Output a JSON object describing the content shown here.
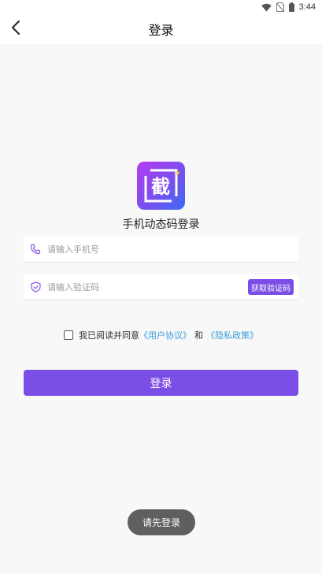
{
  "status_bar": {
    "time": "3:44",
    "icons": [
      "wifi-icon",
      "no-sim-icon",
      "battery-icon"
    ]
  },
  "header": {
    "title": "登录",
    "back_icon": "chevron-left-icon"
  },
  "logo": {
    "glyph": "截"
  },
  "subtitle": "手机动态码登录",
  "phone_field": {
    "icon": "phone-icon",
    "placeholder": "请输入手机号",
    "value": ""
  },
  "code_field": {
    "icon": "shield-icon",
    "placeholder": "请输入验证码",
    "value": "",
    "button_label": "获取验证码"
  },
  "agreement": {
    "checked": false,
    "prefix": "我已阅读并同意",
    "user_agreement": "《用户协议》",
    "and": "和",
    "privacy_policy": "《隐私政策》"
  },
  "login_button_label": "登录",
  "toast": "请先登录",
  "colors": {
    "accent": "#7b4fe6",
    "link": "#3a9ed8",
    "toast_bg": "#5f5f5f"
  }
}
